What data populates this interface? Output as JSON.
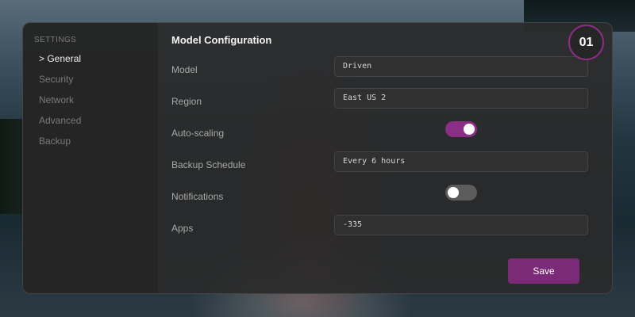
{
  "sidebar": {
    "heading": "SETTINGS",
    "items": [
      {
        "label": "> General",
        "active": true
      },
      {
        "label": "Security",
        "active": false
      },
      {
        "label": "Network",
        "active": false
      },
      {
        "label": "Advanced",
        "active": false
      },
      {
        "label": "Backup",
        "active": false
      }
    ]
  },
  "main": {
    "title": "Model Configuration",
    "step_badge": "01",
    "fields": {
      "model": {
        "label": "Model",
        "value": "Driven"
      },
      "region": {
        "label": "Region",
        "value": "East US 2"
      },
      "auto_scaling": {
        "label": "Auto-scaling",
        "enabled": true
      },
      "backup_schedule": {
        "label": "Backup Schedule",
        "value": "Every 6 hours"
      },
      "notifications": {
        "label": "Notifications",
        "enabled": false
      },
      "apps": {
        "label": "Apps",
        "value": "-335"
      }
    },
    "save_label": "Save"
  },
  "colors": {
    "accent": "#8b2e86",
    "panel": "#2a2a2a",
    "sidebar": "#242424"
  }
}
